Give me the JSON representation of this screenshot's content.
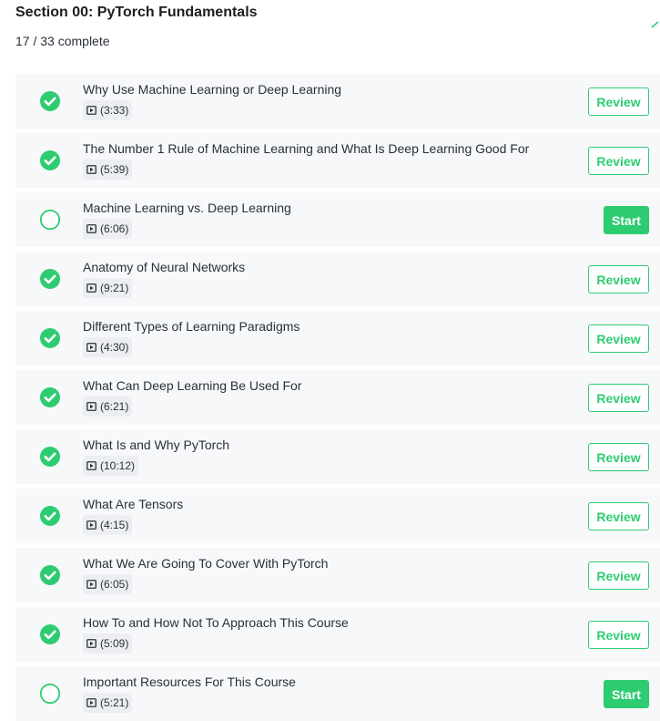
{
  "section": {
    "title": "Section 00: PyTorch Fundamentals",
    "progress": "17 / 33 complete"
  },
  "colors": {
    "accent": "#2ecc71",
    "row_bg": "#f7f8fa",
    "text": "#29303b"
  },
  "lectures": [
    {
      "title": "Why Use Machine Learning or Deep Learning",
      "duration": "(3:33)",
      "completed": true,
      "action": "Review"
    },
    {
      "title": "The Number 1 Rule of Machine Learning and What Is Deep Learning Good For",
      "duration": "(5:39)",
      "completed": true,
      "action": "Review"
    },
    {
      "title": "Machine Learning vs. Deep Learning",
      "duration": "(6:06)",
      "completed": false,
      "action": "Start"
    },
    {
      "title": "Anatomy of Neural Networks",
      "duration": "(9:21)",
      "completed": true,
      "action": "Review"
    },
    {
      "title": "Different Types of Learning Paradigms",
      "duration": "(4:30)",
      "completed": true,
      "action": "Review"
    },
    {
      "title": "What Can Deep Learning Be Used For",
      "duration": "(6:21)",
      "completed": true,
      "action": "Review"
    },
    {
      "title": "What Is and Why PyTorch",
      "duration": "(10:12)",
      "completed": true,
      "action": "Review"
    },
    {
      "title": "What Are Tensors",
      "duration": "(4:15)",
      "completed": true,
      "action": "Review"
    },
    {
      "title": "What We Are Going To Cover With PyTorch",
      "duration": "(6:05)",
      "completed": true,
      "action": "Review"
    },
    {
      "title": "How To and How Not To Approach This Course",
      "duration": "(5:09)",
      "completed": true,
      "action": "Review"
    },
    {
      "title": "Important Resources For This Course",
      "duration": "(5:21)",
      "completed": false,
      "action": "Start"
    }
  ]
}
